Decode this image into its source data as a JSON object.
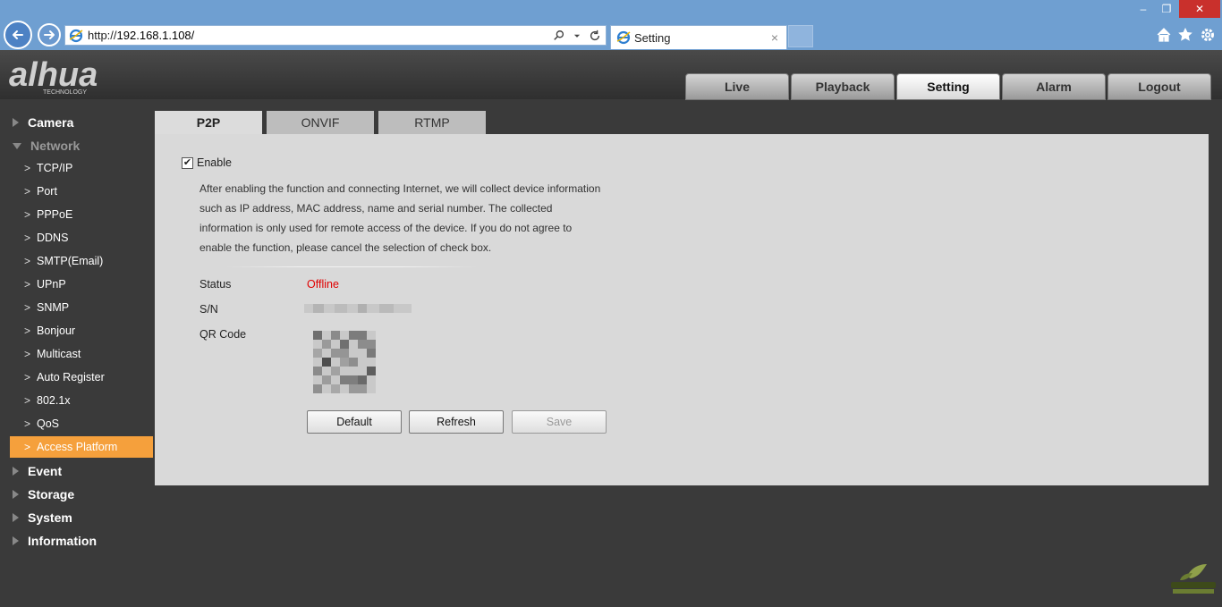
{
  "browser": {
    "url_prefix": "http://",
    "url_host": "192.168.1.108/",
    "tab_title": "Setting",
    "tab_close": "×",
    "win_min": "–",
    "win_restore": "❐",
    "win_close": "✕"
  },
  "brand": {
    "logo_text": "alhua",
    "logo_sub": "TECHNOLOGY",
    "accent_color": "#f5a03c"
  },
  "top_nav": {
    "tabs": [
      {
        "label": "Live"
      },
      {
        "label": "Playback"
      },
      {
        "label": "Setting",
        "active": true
      },
      {
        "label": "Alarm"
      },
      {
        "label": "Logout"
      }
    ]
  },
  "sidebar": {
    "groups": {
      "camera": "Camera",
      "network": "Network",
      "event": "Event",
      "storage": "Storage",
      "system": "System",
      "information": "Information"
    },
    "network_items": [
      {
        "label": "TCP/IP"
      },
      {
        "label": "Port"
      },
      {
        "label": "PPPoE"
      },
      {
        "label": "DDNS"
      },
      {
        "label": "SMTP(Email)"
      },
      {
        "label": "UPnP"
      },
      {
        "label": "SNMP"
      },
      {
        "label": "Bonjour"
      },
      {
        "label": "Multicast"
      },
      {
        "label": "Auto Register"
      },
      {
        "label": "802.1x"
      },
      {
        "label": "QoS"
      },
      {
        "label": "Access Platform",
        "active": true
      }
    ]
  },
  "content_tabs": [
    {
      "label": "P2P",
      "active": true
    },
    {
      "label": "ONVIF"
    },
    {
      "label": "RTMP"
    }
  ],
  "p2p": {
    "enable_label": "Enable",
    "enable_checked": true,
    "description_lines": [
      "After enabling the function and connecting Internet, we will collect device information",
      "such as IP address, MAC address, name and serial number. The collected",
      "information is only used for remote access of the device. If you do not agree to",
      "enable the function, please cancel the selection of check box."
    ],
    "status_label": "Status",
    "status_value": "Offline",
    "status_color": "#e00000",
    "sn_label": "S/N",
    "qr_label": "QR Code",
    "buttons": {
      "default": "Default",
      "refresh": "Refresh",
      "save": "Save"
    }
  }
}
